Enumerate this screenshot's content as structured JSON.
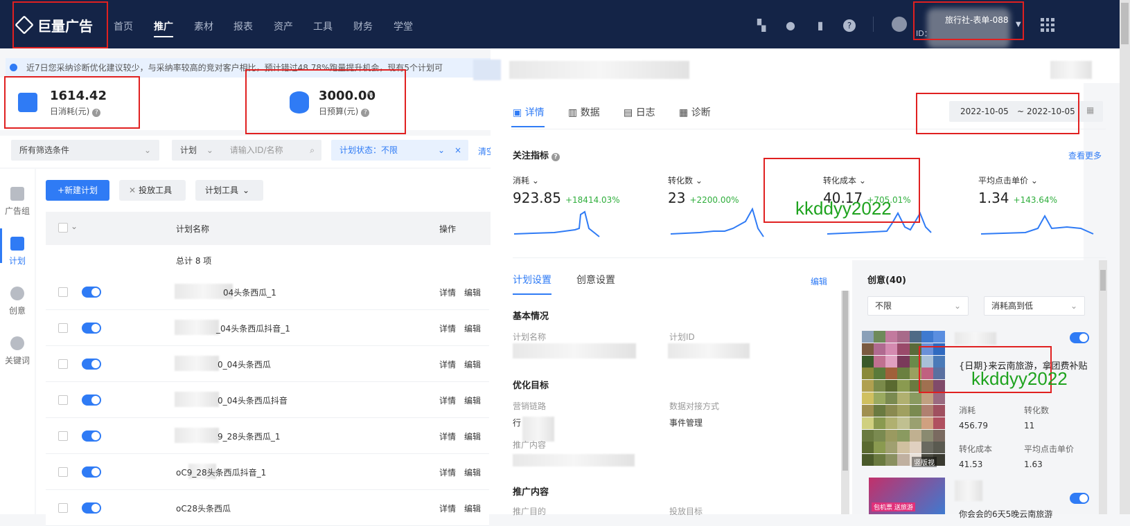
{
  "brand": {
    "name": "巨量广告"
  },
  "nav": {
    "items": [
      "首页",
      "推广",
      "素材",
      "报表",
      "资产",
      "工具",
      "财务",
      "学堂"
    ],
    "active": "推广"
  },
  "account": {
    "name": "旅行社-表单-088",
    "id_prefix": "ID："
  },
  "notice": {
    "text": "近7日您采纳诊断优化建议较少，与采纳率较高的竞对客户相比，预计错过48.78%跑量提升机会，现有5个计划可"
  },
  "stats": {
    "spend_value": "1614.42",
    "spend_label": "日消耗(元)",
    "budget_value": "3000.00",
    "budget_label": "日预算(元)"
  },
  "filters": {
    "all_conditions": "所有筛选条件",
    "plan_select": "计划",
    "search_placeholder": "请输入ID/名称",
    "status_chip": "计划状态：不限",
    "clear": "清空"
  },
  "sidebar": {
    "items": [
      "广告组",
      "计划",
      "创意",
      "关键词"
    ]
  },
  "toolbar": {
    "new_plan": "+新建计划",
    "launch_tool": "投放工具",
    "plan_tool": "计划工具"
  },
  "table": {
    "col_name": "计划名称",
    "col_action": "操作",
    "total": "总计 8 项",
    "action_detail": "详情",
    "action_edit": "编辑",
    "rows": [
      {
        "name": "04头条西瓜_1"
      },
      {
        "name": "_04头条西瓜抖音_1"
      },
      {
        "name": "0_04头条西瓜"
      },
      {
        "name": "0_04头条西瓜抖音"
      },
      {
        "name": "9_28头条西瓜_1"
      },
      {
        "name": "oC9_28头条西瓜抖音_1"
      },
      {
        "name": "oC28头条西瓜"
      }
    ]
  },
  "panel": {
    "tabs": [
      "详情",
      "数据",
      "日志",
      "诊断"
    ],
    "date_start": "2022-10-05",
    "date_sep": "~",
    "date_end": "2022-10-05",
    "focus_title": "关注指标",
    "see_more": "查看更多",
    "metrics": [
      {
        "label": "消耗",
        "value": "923.85",
        "delta": "+18414.03%"
      },
      {
        "label": "转化数",
        "value": "23",
        "delta": "+2200.00%"
      },
      {
        "label": "转化成本",
        "value": "40.17",
        "delta": "+705.01%"
      },
      {
        "label": "平均点击单价",
        "value": "1.34",
        "delta": "+143.64%"
      }
    ],
    "watermark": "kkddyy2022",
    "settings_tabs": [
      "计划设置",
      "创意设置"
    ],
    "edit": "编辑",
    "basic_title": "基本情况",
    "plan_name_label": "计划名称",
    "plan_id_label": "计划ID",
    "opt_title": "优化目标",
    "marketing_label": "营销链路",
    "marketing_val": "行",
    "data_label": "数据对接方式",
    "data_val": "事件管理",
    "promo_label": "推广内容",
    "promo_title": "推广内容",
    "promo_goal_label": "推广目的",
    "launch_goal_label": "投放目标",
    "creative_title": "创意(40)",
    "creative_filter": "不限",
    "creative_sort": "消耗高到低",
    "creative_text": "{日期}来云南旅游，拿团费补贴",
    "creative_badge": "竖版视",
    "creative_badge2": "包机票 送旅游",
    "creative_metrics": [
      {
        "label": "消耗",
        "value": "456.79"
      },
      {
        "label": "转化数",
        "value": "11"
      },
      {
        "label": "转化成本",
        "value": "41.53"
      },
      {
        "label": "平均点击单价",
        "value": "1.63"
      }
    ],
    "creative_text2": "你会会的6天5晚云南旅游"
  },
  "colors": {
    "topbar": "#142447",
    "primary": "#2f7bf5",
    "delta": "#2fae3c",
    "watermark": "#1fa31f",
    "highlight": "#e02020"
  }
}
